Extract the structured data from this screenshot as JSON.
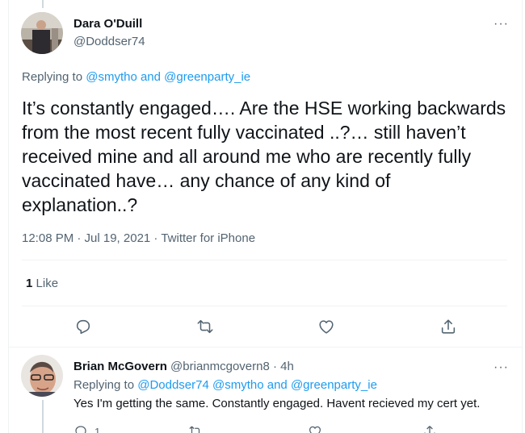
{
  "main_tweet": {
    "author_name": "Dara O'Duill",
    "author_handle": "@Doddser74",
    "more_label": "···",
    "replying_prefix": "Replying to",
    "replying_user1": "@smytho",
    "replying_and": "and",
    "replying_user2": "@greenparty_ie",
    "text": "It’s constantly engaged…. Are the HSE working backwards from the most recent fully vaccinated ..?… still haven’t received mine and all around me who are recently fully vaccinated have… any chance of any kind of explanation..?",
    "timestamp": "12:08 PM · Jul 19, 2021 · Twitter for iPhone",
    "like_count": "1",
    "like_label": "Like",
    "icons": {
      "reply": "reply-icon",
      "retweet": "retweet-icon",
      "like": "like-icon",
      "share": "share-icon"
    }
  },
  "reply_tweet": {
    "author_name": "Brian McGovern",
    "author_handle": "@brianmcgovern8",
    "time": "· 4h",
    "more_label": "···",
    "replying_prefix": "Replying to",
    "replying_user1": "@Doddser74",
    "replying_user2": "@smytho",
    "replying_and": "and",
    "replying_user3": "@greenparty_ie",
    "text": "Yes I'm getting the same. Constantly engaged. Havent recieved my cert yet.",
    "reply_count": "1"
  },
  "colors": {
    "accent": "#1d9bf0",
    "text_primary": "#0f1419",
    "text_secondary": "#536471",
    "divider": "#eff3f4"
  }
}
